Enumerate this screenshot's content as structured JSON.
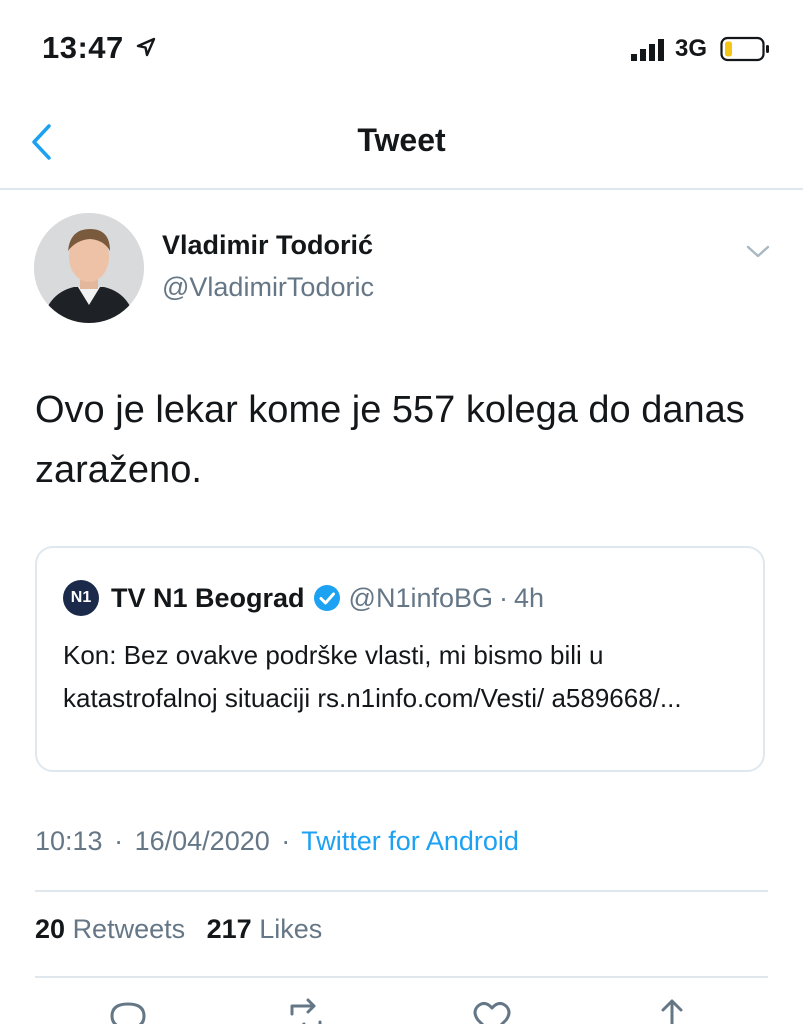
{
  "status_bar": {
    "time": "13:47",
    "network": "3G",
    "icons": [
      "location-arrow-icon",
      "signal-icon",
      "battery-icon"
    ],
    "battery_color": "#f5c518"
  },
  "nav": {
    "back_icon": "chevron-left-icon",
    "title": "Tweet"
  },
  "tweet": {
    "author": {
      "display_name": "Vladimir Todorić",
      "handle": "@VladimirTodoric"
    },
    "text": "Ovo je lekar kome je 557 kolega do danas zaraženo.",
    "quoted": {
      "logo_text": "N1",
      "name": "TV N1 Beograd",
      "handle": "@N1infoBG",
      "separator": "·",
      "age": "4h",
      "text": "Kon: Bez ovakve podrške vlasti, mi bismo bili u katastrofalnoj situaciji rs.n1info.com/Vesti/ a589668/..."
    },
    "time": "10:13",
    "date": "16/04/2020",
    "separator": "·",
    "source": "Twitter for Android",
    "retweets_count": "20",
    "retweets_label": "Retweets",
    "likes_count": "217",
    "likes_label": "Likes"
  },
  "colors": {
    "accent": "#1da1f2",
    "secondary_text": "#657786",
    "divider": "#e1e8ed"
  },
  "actions": [
    "reply-icon",
    "retweet-icon",
    "like-icon",
    "share-icon"
  ]
}
